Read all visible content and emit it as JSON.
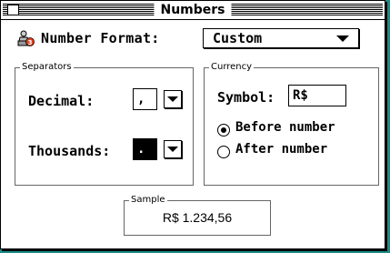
{
  "window": {
    "title": "Numbers"
  },
  "number_format": {
    "label": "Number Format:",
    "selected": "Custom",
    "icon": "number-format-icon"
  },
  "separators": {
    "group_label": "Separators",
    "decimal_label": "Decimal:",
    "decimal_value": ",",
    "thousands_label": "Thousands:",
    "thousands_value": "."
  },
  "currency": {
    "group_label": "Currency",
    "symbol_label": "Symbol:",
    "symbol_value": "R$",
    "options": [
      {
        "label": "Before number",
        "selected": true
      },
      {
        "label": "After number",
        "selected": false
      }
    ]
  },
  "sample": {
    "group_label": "Sample",
    "value": "R$ 1.234,56"
  },
  "colors": {
    "desktop": "#1e8a86",
    "window": "#ffffff",
    "frame": "#000000"
  }
}
